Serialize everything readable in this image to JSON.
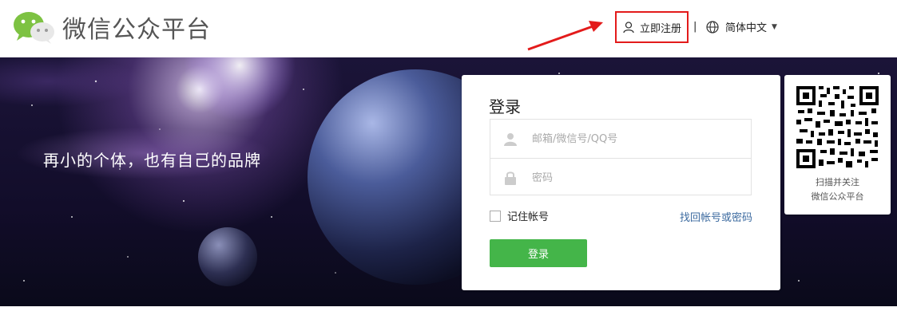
{
  "header": {
    "logo_text": "微信公众平台",
    "register_label": "立即注册",
    "separator": "|",
    "language_label": "简体中文"
  },
  "banner": {
    "slogan": "再小的个体，也有自己的品牌"
  },
  "login": {
    "title": "登录",
    "account_placeholder": "邮箱/微信号/QQ号",
    "password_placeholder": "密码",
    "remember_label": "记住帐号",
    "forgot_label": "找回帐号或密码",
    "submit_label": "登录"
  },
  "qr": {
    "line1": "扫描并关注",
    "line2": "微信公众平台"
  },
  "colors": {
    "accent_green": "#44b549",
    "highlight_red": "#e31b1b",
    "link_blue": "#3d6ba0"
  },
  "icons": [
    "wechat-logo-icon",
    "user-icon",
    "globe-icon",
    "lock-icon",
    "arrow-icon",
    "qr-code-icon"
  ]
}
